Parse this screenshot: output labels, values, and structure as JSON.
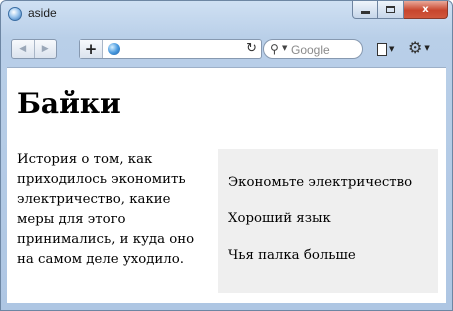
{
  "window": {
    "title": "aside",
    "minimize_label": "",
    "maximize_label": "",
    "close_label": "x"
  },
  "toolbar": {
    "back_icon": "back-arrow-icon",
    "forward_icon": "forward-arrow-icon",
    "add_label": "+",
    "address_value": "",
    "reload_icon": "reload-icon",
    "search_placeholder": "Google",
    "page_menu_icon": "page-icon",
    "settings_menu_icon": "gear-icon"
  },
  "page": {
    "title": "Байки",
    "story": "История о том, как приходилось экономить электричество, какие меры для этого принимались, и куда оно на самом деле уходило.",
    "aside_items": [
      "Экономьте электричество",
      "Хороший язык",
      "Чья палка больше"
    ]
  },
  "colors": {
    "aside_background": "#efefef",
    "window_frame": "#aec6e3",
    "close_button": "#c8452d"
  }
}
